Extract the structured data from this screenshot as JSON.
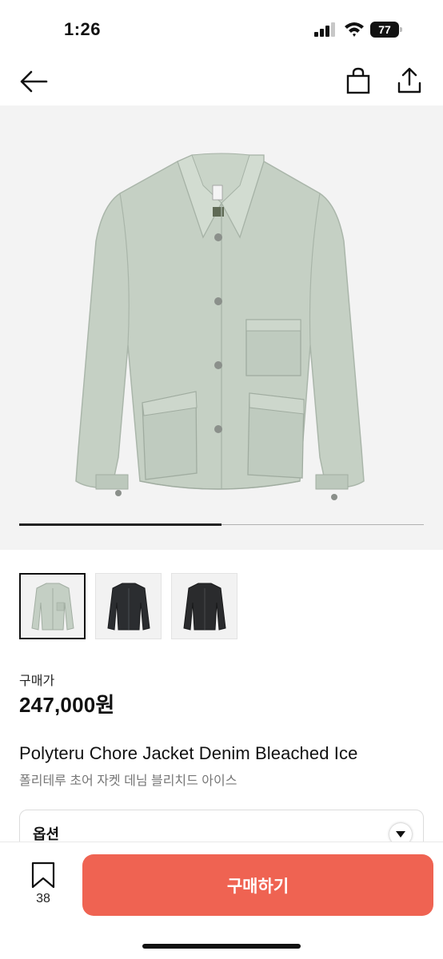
{
  "status_bar": {
    "time": "1:26",
    "battery_percent": "77",
    "icons": [
      "signal-icon",
      "wifi-icon",
      "battery-icon"
    ]
  },
  "nav": {
    "icons": [
      "back-arrow-icon",
      "shopping-bag-icon",
      "share-icon"
    ]
  },
  "hero": {
    "image": "mint bleached denim chore jacket",
    "carousel_progress": 0.5
  },
  "thumbnails": [
    {
      "name": "mint bleached denim jacket",
      "color": "#c4cfc4",
      "selected": true
    },
    {
      "name": "black denim jacket",
      "color": "#2b2d30",
      "selected": false
    },
    {
      "name": "black denim jacket alternate",
      "color": "#2a2b2d",
      "selected": false
    }
  ],
  "price": {
    "label": "구매가",
    "value": "247,000원"
  },
  "product": {
    "title_en": "Polyteru Chore Jacket Denim Bleached Ice",
    "title_ko": "폴리테루 초어 자켓 데님 블리치드 아이스"
  },
  "option": {
    "label": "옵션"
  },
  "bottom": {
    "bookmark_count": "38",
    "buy_label": "구매하기"
  },
  "colors": {
    "accent": "#ef6352",
    "jacket": "#c4cfc4",
    "hero_bg": "#f3f3f3"
  }
}
